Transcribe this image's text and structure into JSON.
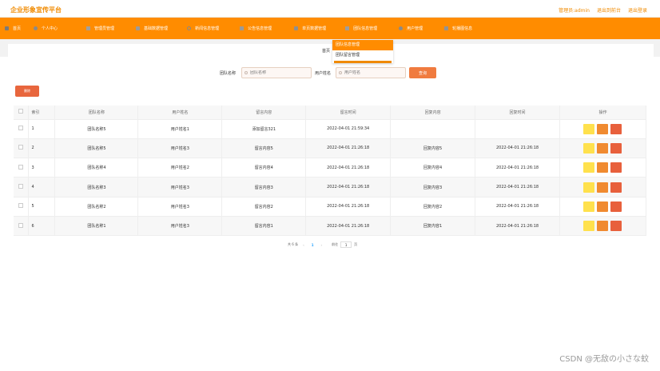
{
  "app": {
    "brand": "企业形象宣传平台",
    "admin_label": "管理员:admin",
    "to_frontend": "退出到前台",
    "logout": "退出登录"
  },
  "nav": [
    {
      "label": "首页",
      "icon": "home-icon"
    },
    {
      "label": "个人中心",
      "icon": "person-icon"
    },
    {
      "label": "管理员管理",
      "icon": "square-icon"
    },
    {
      "label": "基础数据管理",
      "icon": "cube-icon"
    },
    {
      "label": "新闻信息管理",
      "icon": "ring-icon"
    },
    {
      "label": "公告信息管理",
      "icon": "trash-icon"
    },
    {
      "label": "单页数据管理",
      "icon": "tag-icon"
    },
    {
      "label": "团队信息管理",
      "icon": "layer-icon"
    },
    {
      "label": "用户管理",
      "icon": "user-icon"
    },
    {
      "label": "轮播图信息",
      "icon": "image-icon"
    }
  ],
  "dropdown": {
    "items": [
      "团队信息管理",
      "团队留言管理"
    ]
  },
  "breadcrumb": {
    "home": "首页",
    "current": ""
  },
  "search": {
    "team_label": "团队名称",
    "team_placeholder": "团队名称",
    "user_label": "用户姓名",
    "user_placeholder": "用户姓名",
    "query_button": "查询"
  },
  "delete_button": "删除",
  "table": {
    "headers": [
      "",
      "索引",
      "团队名称",
      "用户姓名",
      "留言内容",
      "留言时间",
      "回复内容",
      "回复时间",
      "操作"
    ],
    "rows": [
      {
        "idx": "1",
        "team": "团队名称5",
        "user": "用户姓名1",
        "content": "添加留言321",
        "time": "2022-04-01 21:59:34",
        "reply": "",
        "reply_time": ""
      },
      {
        "idx": "2",
        "team": "团队名称5",
        "user": "用户姓名3",
        "content": "留言内容5",
        "time": "2022-04-01 21:26:18",
        "reply": "回复内容5",
        "reply_time": "2022-04-01 21:26:18"
      },
      {
        "idx": "3",
        "team": "团队名称4",
        "user": "用户姓名2",
        "content": "留言内容4",
        "time": "2022-04-01 21:26:18",
        "reply": "回复内容4",
        "reply_time": "2022-04-01 21:26:18"
      },
      {
        "idx": "4",
        "team": "团队名称3",
        "user": "用户姓名3",
        "content": "留言内容3",
        "time": "2022-04-01 21:26:18",
        "reply": "回复内容3",
        "reply_time": "2022-04-01 21:26:18"
      },
      {
        "idx": "5",
        "team": "团队名称2",
        "user": "用户姓名3",
        "content": "留言内容2",
        "time": "2022-04-01 21:26:18",
        "reply": "回复内容2",
        "reply_time": "2022-04-01 21:26:18"
      },
      {
        "idx": "6",
        "team": "团队名称1",
        "user": "用户姓名3",
        "content": "留言内容1",
        "time": "2022-04-01 21:26:18",
        "reply": "回复内容1",
        "reply_time": "2022-04-01 21:26:18"
      }
    ]
  },
  "pager": {
    "total": "共 6 条",
    "prev": "‹",
    "current": "1",
    "next": "›",
    "goto_label": "前往",
    "goto_value": "1",
    "page_unit": "页"
  },
  "watermark": "CSDN @无敌の小さな蚊",
  "colors": {
    "primary": "#ff8c00",
    "view_btn": "#ffe14d",
    "edit_btn": "#f08a30",
    "delete_btn": "#e8603c"
  }
}
